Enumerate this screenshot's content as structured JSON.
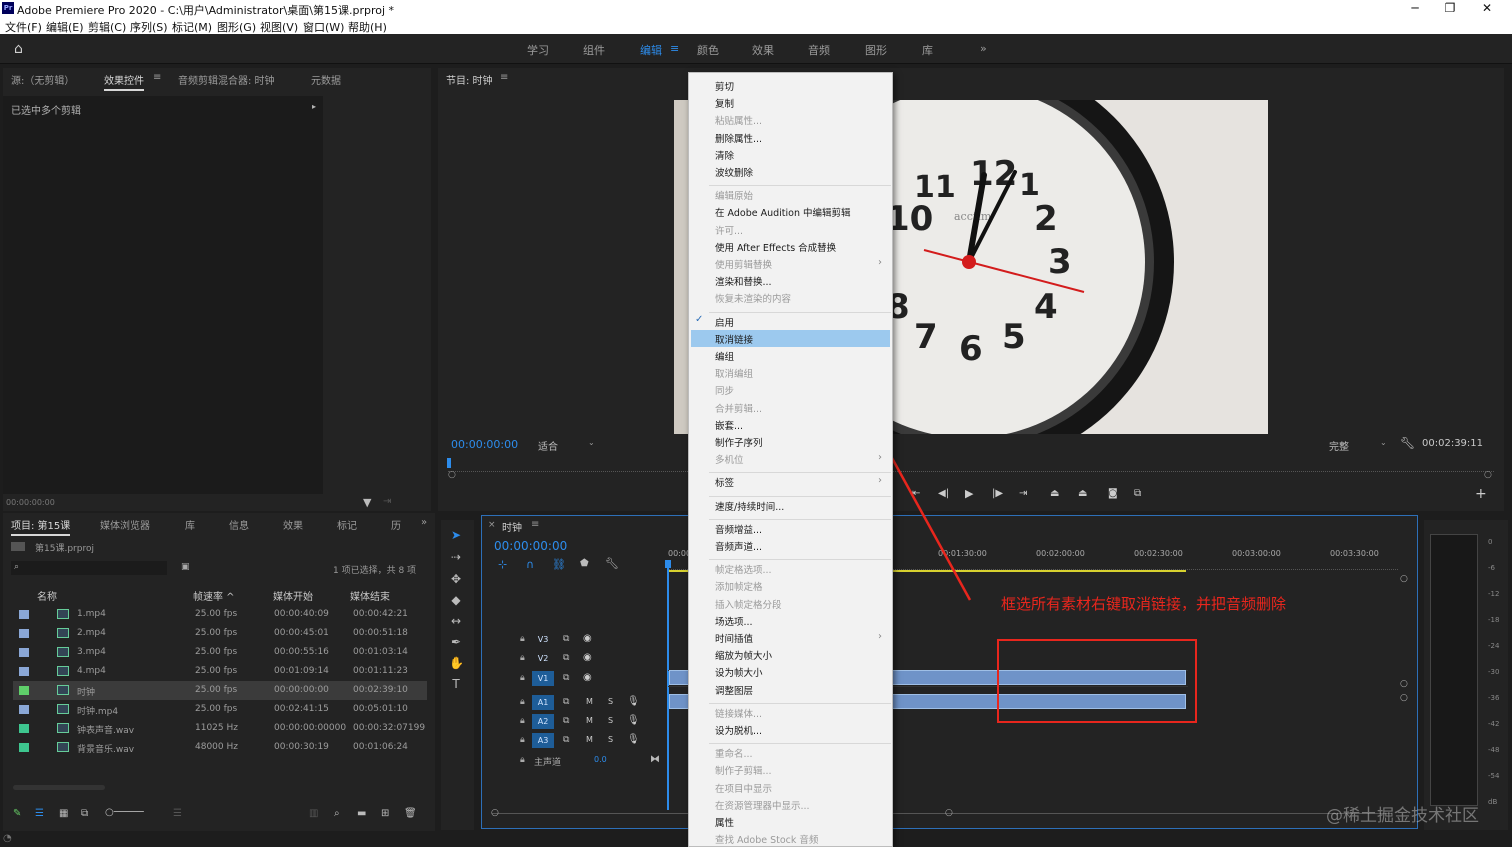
{
  "window": {
    "title": "Adobe Premiere Pro 2020 - C:\\用户\\Administrator\\桌面\\第15课.prproj *",
    "icon_label": "Pr",
    "minimize": "─",
    "maximize": "❐",
    "close": "✕"
  },
  "menubar": [
    "文件(F)",
    "编辑(E)",
    "剪辑(C)",
    "序列(S)",
    "标记(M)",
    "图形(G)",
    "视图(V)",
    "窗口(W)",
    "帮助(H)"
  ],
  "workspaces": [
    "学习",
    "组件",
    "编辑",
    "颜色",
    "效果",
    "音频",
    "图形",
    "库",
    "»"
  ],
  "workspace_active": "编辑",
  "source_panel": {
    "tabs": [
      "源:（无剪辑）",
      "效果控件",
      "音频剪辑混合器: 时钟",
      "元数据"
    ],
    "active_tab": "效果控件",
    "message": "已选中多个剪辑",
    "timecode": "00:00:00:00"
  },
  "program_monitor": {
    "title": "节目: 时钟",
    "timecode": "00:00:00:00",
    "fit": "适合",
    "quality": "完整",
    "duration": "00:02:39:11",
    "clock_numbers": [
      "12",
      "1",
      "2",
      "3",
      "4",
      "5",
      "6",
      "7",
      "8",
      "10",
      "11"
    ],
    "clock_brand": "acctim"
  },
  "project_panel": {
    "tabs": [
      "项目: 第15课",
      "媒体浏览器",
      "库",
      "信息",
      "效果",
      "标记",
      "历"
    ],
    "active_tab": "项目: 第15课",
    "file": "第15课.prproj",
    "selection": "1 项已选择，共 8 项",
    "columns": [
      "名称",
      "帧速率 ^",
      "媒体开始",
      "媒体结束"
    ],
    "rows": [
      {
        "name": "1.mp4",
        "rate": "25.00 fps",
        "start": "00:00:40:09",
        "end": "00:00:42:21",
        "color": "#8aa7d6"
      },
      {
        "name": "2.mp4",
        "rate": "25.00 fps",
        "start": "00:00:45:01",
        "end": "00:00:51:18",
        "color": "#8aa7d6"
      },
      {
        "name": "3.mp4",
        "rate": "25.00 fps",
        "start": "00:00:55:16",
        "end": "00:01:03:14",
        "color": "#8aa7d6"
      },
      {
        "name": "4.mp4",
        "rate": "25.00 fps",
        "start": "00:01:09:14",
        "end": "00:01:11:23",
        "color": "#8aa7d6"
      },
      {
        "name": "时钟",
        "rate": "25.00 fps",
        "start": "00:00:00:00",
        "end": "00:02:39:10",
        "color": "#5fcf6a"
      },
      {
        "name": "时钟.mp4",
        "rate": "25.00 fps",
        "start": "00:02:41:15",
        "end": "00:05:01:10",
        "color": "#8aa7d6"
      },
      {
        "name": "钟表声音.wav",
        "rate": "11025 Hz",
        "start": "00:00:00:00000",
        "end": "00:00:32:07199",
        "color": "#3ec68f"
      },
      {
        "name": "背景音乐.wav",
        "rate": "48000 Hz",
        "start": "00:00:30:19",
        "end": "00:01:06:24",
        "color": "#3ec68f"
      }
    ]
  },
  "timeline": {
    "title": "时钟",
    "timecode": "00:00:00:00",
    "ruler": [
      "00:00",
      "00:01:30:00",
      "00:02:00:00",
      "00:02:30:00",
      "00:03:00:00",
      "00:03:30:00"
    ],
    "tracks": [
      {
        "id": "V3",
        "kind": "video"
      },
      {
        "id": "V2",
        "kind": "video"
      },
      {
        "id": "V1",
        "kind": "video"
      },
      {
        "id": "A1",
        "kind": "audio"
      },
      {
        "id": "A2",
        "kind": "audio"
      },
      {
        "id": "A3",
        "kind": "audio"
      }
    ],
    "master": "主声道",
    "master_value": "0.0",
    "m_label": "M",
    "s_label": "S"
  },
  "context_menu": {
    "highlighted": "取消链接",
    "checked": "启用",
    "items": [
      {
        "label": "剪切",
        "enabled": true
      },
      {
        "label": "复制",
        "enabled": true
      },
      {
        "label": "粘贴属性...",
        "enabled": false
      },
      {
        "label": "删除属性...",
        "enabled": true
      },
      {
        "label": "清除",
        "enabled": true
      },
      {
        "label": "波纹删除",
        "enabled": true
      },
      {
        "label": "编辑原始",
        "enabled": false,
        "sep_before": true
      },
      {
        "label": "在 Adobe Audition 中编辑剪辑",
        "enabled": true
      },
      {
        "label": "许可...",
        "enabled": false
      },
      {
        "label": "使用 After Effects 合成替换",
        "enabled": true
      },
      {
        "label": "使用剪辑替换",
        "enabled": false,
        "submenu": true
      },
      {
        "label": "渲染和替换...",
        "enabled": true
      },
      {
        "label": "恢复未渲染的内容",
        "enabled": false
      },
      {
        "label": "启用",
        "enabled": true,
        "sep_before": true
      },
      {
        "label": "取消链接",
        "enabled": true
      },
      {
        "label": "编组",
        "enabled": true
      },
      {
        "label": "取消编组",
        "enabled": false
      },
      {
        "label": "同步",
        "enabled": false
      },
      {
        "label": "合并剪辑...",
        "enabled": false
      },
      {
        "label": "嵌套...",
        "enabled": true
      },
      {
        "label": "制作子序列",
        "enabled": true
      },
      {
        "label": "多机位",
        "enabled": false,
        "submenu": true
      },
      {
        "label": "标签",
        "enabled": true,
        "submenu": true,
        "sep_before": true
      },
      {
        "label": "速度/持续时间...",
        "enabled": true,
        "sep_before": true
      },
      {
        "label": "音频增益...",
        "enabled": true,
        "sep_before": true
      },
      {
        "label": "音频声道...",
        "enabled": true
      },
      {
        "label": "帧定格选项...",
        "enabled": false,
        "sep_before": true
      },
      {
        "label": "添加帧定格",
        "enabled": false
      },
      {
        "label": "插入帧定格分段",
        "enabled": false
      },
      {
        "label": "场选项...",
        "enabled": true
      },
      {
        "label": "时间插值",
        "enabled": true,
        "submenu": true
      },
      {
        "label": "缩放为帧大小",
        "enabled": true
      },
      {
        "label": "设为帧大小",
        "enabled": true
      },
      {
        "label": "调整图层",
        "enabled": true
      },
      {
        "label": "链接媒体...",
        "enabled": false,
        "sep_before": true
      },
      {
        "label": "设为脱机...",
        "enabled": true
      },
      {
        "label": "重命名...",
        "enabled": false,
        "sep_before": true
      },
      {
        "label": "制作子剪辑...",
        "enabled": false
      },
      {
        "label": "在项目中显示",
        "enabled": false
      },
      {
        "label": "在资源管理器中显示...",
        "enabled": false
      },
      {
        "label": "属性",
        "enabled": true
      },
      {
        "label": "查找 Adobe Stock 音频",
        "enabled": false
      }
    ]
  },
  "annotation": {
    "text": "框选所有素材右键取消链接，并把音频删除",
    "color": "#e8261d"
  },
  "meters": [
    "0",
    "-6",
    "-12",
    "-18",
    "-24",
    "-30",
    "-36",
    "-42",
    "-48",
    "-54",
    "dB"
  ],
  "watermark": "@稀土掘金技术社区"
}
